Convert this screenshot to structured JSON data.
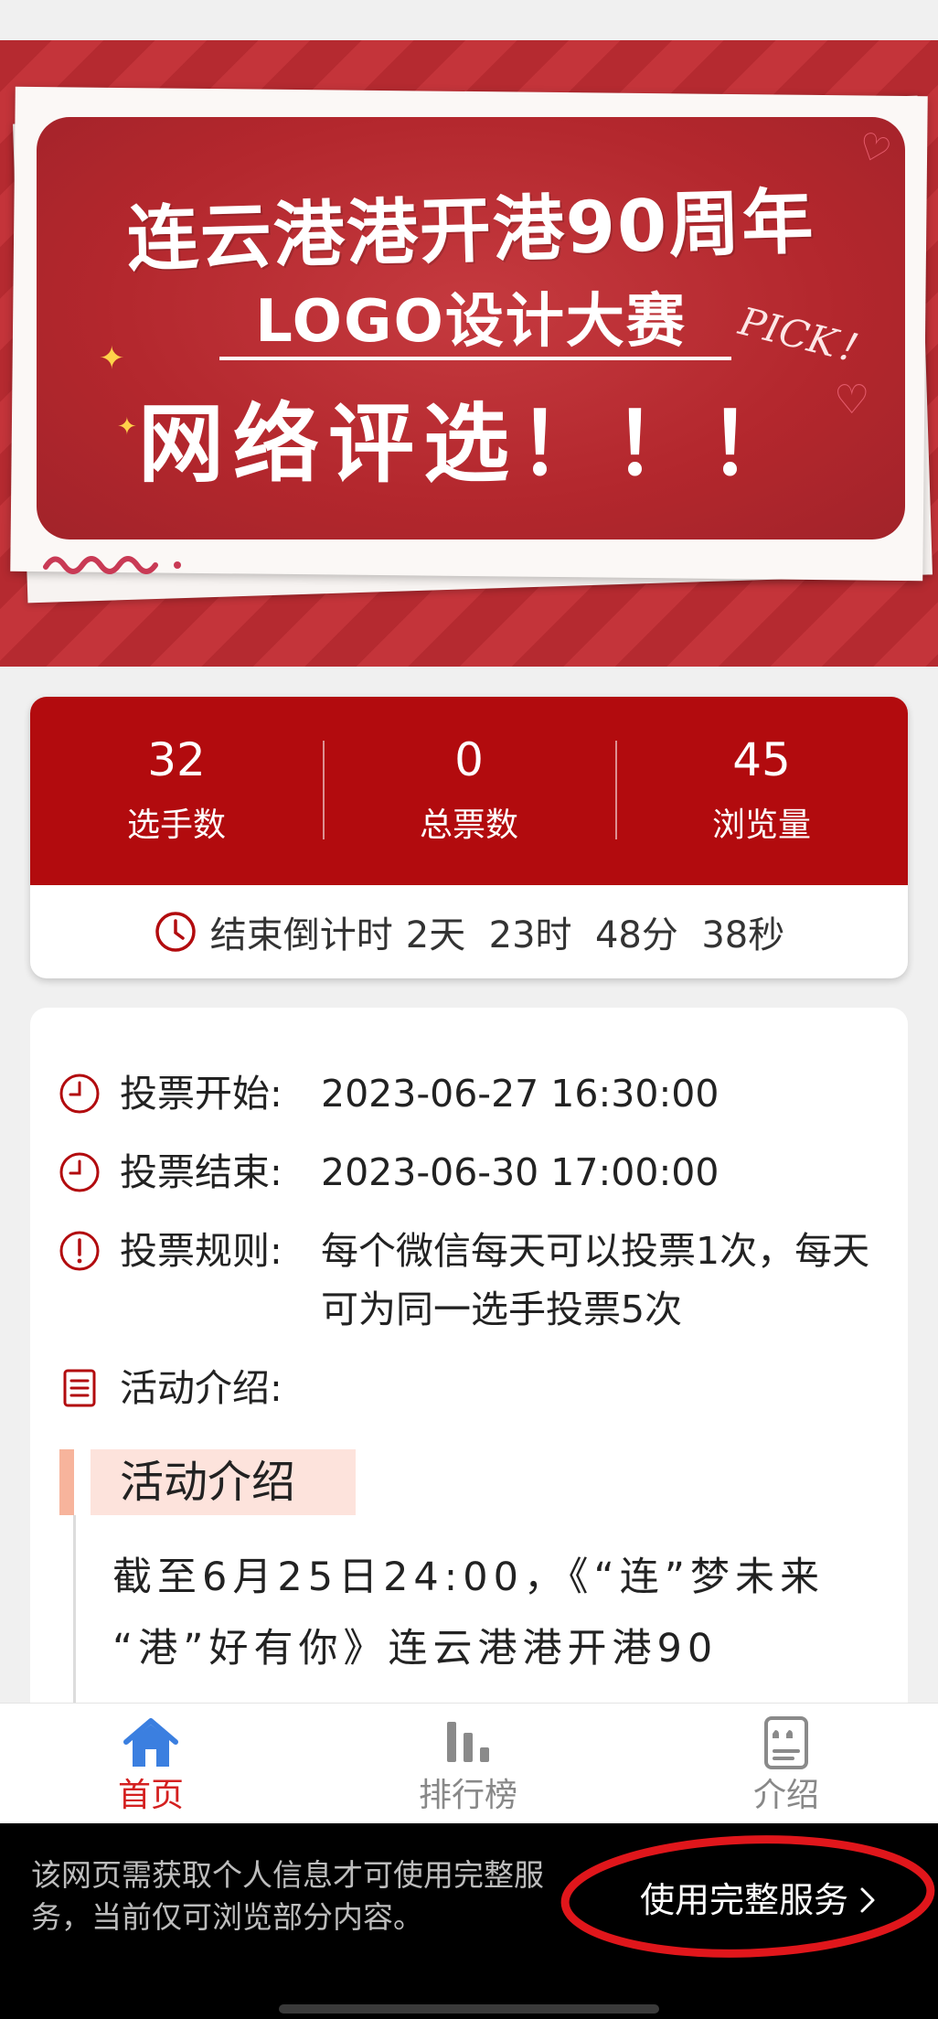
{
  "banner": {
    "title": "连云港港开港90周年",
    "subtitle": "LOGO设计大赛",
    "vote_text": "网络评选！！！",
    "pick": "PICK！"
  },
  "stats": [
    {
      "value": "32",
      "label": "选手数"
    },
    {
      "value": "0",
      "label": "总票数"
    },
    {
      "value": "45",
      "label": "浏览量"
    }
  ],
  "countdown": {
    "label": "结束倒计时",
    "time": "2天  23时  48分  38秒"
  },
  "info": {
    "start_label": "投票开始:",
    "start_value": "2023-06-27 16:30:00",
    "end_label": "投票结束:",
    "end_value": "2023-06-30 17:00:00",
    "rules_label": "投票规则:",
    "rules_value": "每个微信每天可以投票1次，每天可为同一选手投票5次",
    "intro_label": "活动介绍:"
  },
  "intro": {
    "heading": "活动介绍",
    "text": "截至6月25日24:00，《“连”梦未来 “港”好有你》连云港港开港90"
  },
  "tabs": [
    {
      "label": "首页",
      "icon": "home-icon",
      "active": true
    },
    {
      "label": "排行榜",
      "icon": "ranking-icon",
      "active": false
    },
    {
      "label": "介绍",
      "icon": "intro-icon",
      "active": false
    }
  ],
  "auth": {
    "message": "该网页需获取个人信息才可使用完整服务，当前仅可浏览部分内容。",
    "button": "使用完整服务"
  },
  "colors": {
    "primary_red": "#b20b0e",
    "tab_active": "#d42020",
    "tab_icon_active": "#3b7fe0",
    "tab_inactive": "#888888",
    "annotation_red": "#e0161b"
  }
}
